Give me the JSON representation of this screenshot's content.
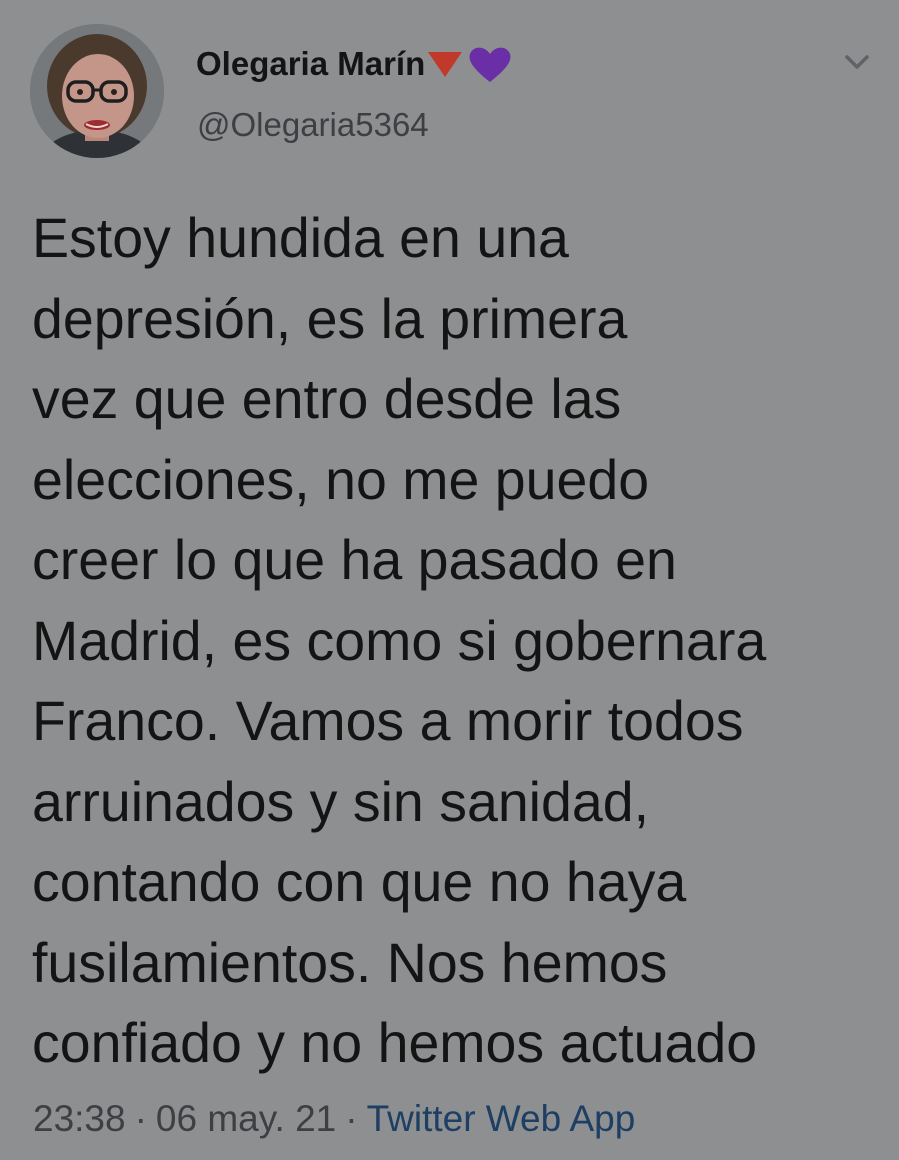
{
  "user": {
    "display_name": "Olegaria Marín",
    "emoji_badges": [
      "down-pointing-red-triangle",
      "purple-heart"
    ],
    "handle": "@Olegaria5364"
  },
  "tweet": {
    "lines": [
      "Estoy hundida en una",
      "depresión, es la primera",
      "vez que entro desde las",
      "elecciones, no me puedo",
      "creer lo que ha pasado en",
      "Madrid, es como si gobernara",
      "Franco. Vamos a morir todos",
      "arruinados y sin sanidad,",
      "contando con que no haya",
      "fusilamientos. Nos hemos",
      "confiado y no hemos actuado"
    ]
  },
  "meta": {
    "time": "23:38",
    "date": "06 may. 21",
    "separator": "·",
    "source": "Twitter Web App"
  },
  "icons": {
    "menu": "chevron-down-icon"
  },
  "colors": {
    "background": "#8e8f91",
    "text": "#141414",
    "secondary_text": "#3d3f42",
    "link": "#1d3f63",
    "triangle_emoji": "#c0392b",
    "heart_emoji": "#6a2ea6"
  }
}
